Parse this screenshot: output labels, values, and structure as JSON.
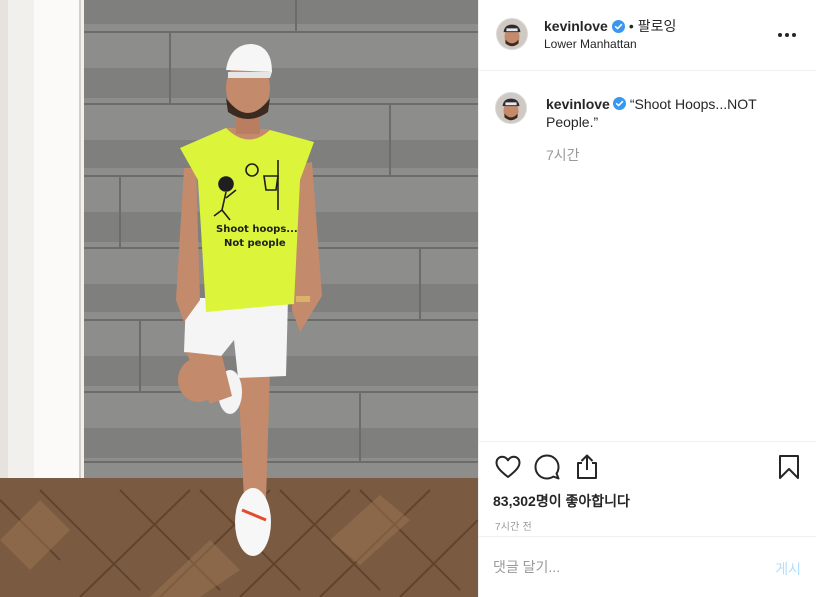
{
  "post": {
    "username": "kevinlove",
    "verified": true,
    "separator": "•",
    "follow_label": "팔로잉",
    "location": "Lower Manhattan",
    "caption": "“Shoot Hoops...NOT People.”",
    "time_ago": "7시간",
    "likes": "83,302명이 좋아합니다",
    "date": "7시간 전"
  },
  "shirt_print": {
    "line1": "Shoot hoops...",
    "line2": "Not people"
  },
  "comment_box": {
    "placeholder": "댓글 달기...",
    "post_label": "게시"
  },
  "icons": {
    "more": "more-options-icon",
    "like": "heart-icon",
    "comment": "comment-bubble-icon",
    "share": "share-icon",
    "save": "bookmark-icon",
    "verified": "verified-badge-icon"
  },
  "colors": {
    "verified": "#3897f0",
    "text": "#262626",
    "muted": "#999999",
    "divider": "#efefef",
    "post_disabled": "#b2dffc",
    "shirt": "#dcf53a"
  }
}
